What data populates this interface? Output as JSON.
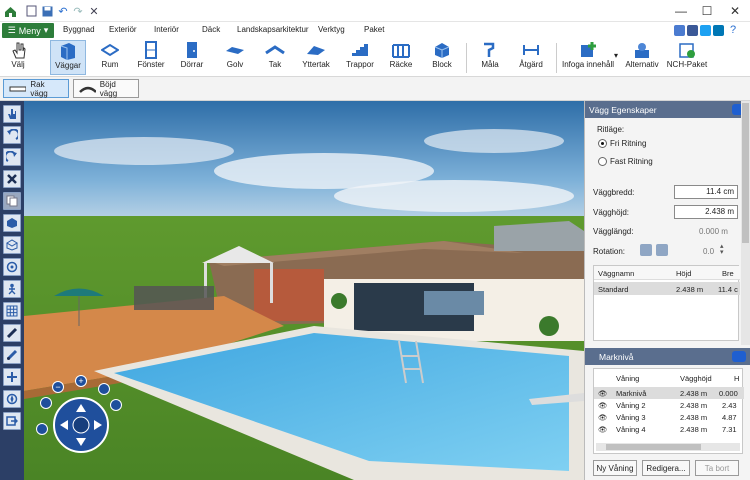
{
  "menu_button": "Meny",
  "tabs": [
    "Byggnad",
    "Exteriör",
    "Interiör",
    "Däck",
    "Landskapsarkitektur",
    "Verktyg",
    "Paket"
  ],
  "ribbon": [
    "Välj",
    "Väggar",
    "Rum",
    "Fönster",
    "Dörrar",
    "Golv",
    "Tak",
    "Yttertak",
    "Trappor",
    "Räcke",
    "Block",
    "Måla",
    "Åtgärd",
    "Infoga innehåll",
    "Alternativ",
    "NCH-Paket"
  ],
  "subbar": {
    "straight_wall": "Rak vägg",
    "curved_wall": "Böjd vägg"
  },
  "wall_props": {
    "title": "Vägg Egenskaper",
    "drawing_label": "Ritläge:",
    "free_drawing": "Fri Ritning",
    "fixed_drawing": "Fast Ritning",
    "width_label": "Väggbredd:",
    "width_value": "11.4 cm",
    "height_label": "Vägghöjd:",
    "height_value": "2.438 m",
    "length_label": "Vägglängd:",
    "length_value": "0.000 m",
    "rotation_label": "Rotation:",
    "rotation_value": "0.0",
    "table_headers": [
      "Väggnamn",
      "Höjd",
      "Bre"
    ],
    "table_row": [
      "Standard",
      "2.438 m",
      "11.4 c"
    ]
  },
  "ground": {
    "title": "Marknivå",
    "headers": [
      "Våning",
      "Vägghöjd",
      "H"
    ],
    "rows": [
      [
        "Marknivå",
        "2.438 m",
        "0.000"
      ],
      [
        "Våning 2",
        "2.438 m",
        "2.43"
      ],
      [
        "Våning 3",
        "2.438 m",
        "4.87"
      ],
      [
        "Våning 4",
        "2.438 m",
        "7.31"
      ]
    ],
    "buttons": [
      "Ny Våning",
      "Redigera...",
      "Ta bort"
    ]
  },
  "colors": {
    "menu_green": "#2d7d3a",
    "panel_header": "#5a6e8e",
    "toolbar_navy": "#2c3f66"
  }
}
